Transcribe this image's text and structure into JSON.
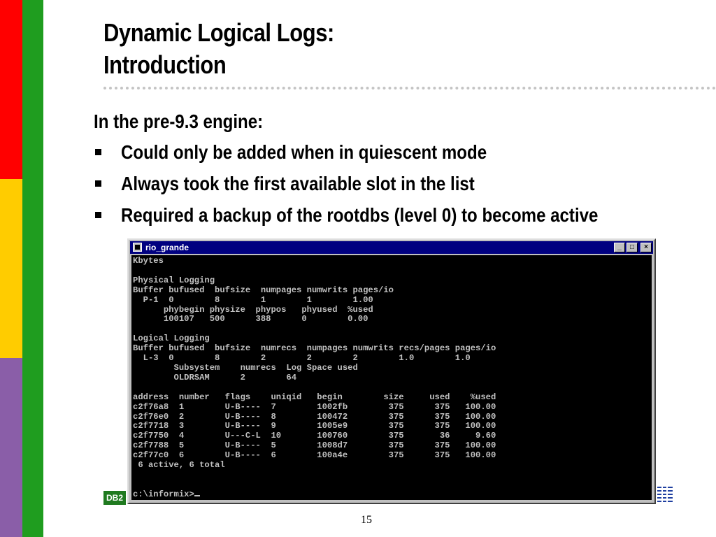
{
  "slide": {
    "title_line1": "Dynamic Logical Logs:",
    "title_line2": "Introduction",
    "intro": "In the pre-9.3 engine:",
    "bullets": [
      "Could only be added when in quiescent mode",
      "Always took the first available slot in the list",
      "Required a backup of the rootdbs (level 0) to become active"
    ],
    "page_number": "15",
    "db2_badge": "DB2",
    "colors": {
      "stripe_red": "#ff0000",
      "stripe_yellow": "#ffcc00",
      "stripe_purple": "#8a5ea8",
      "stripe_green": "#1f9d1f",
      "ibm_blue": "#1f3fa0"
    }
  },
  "window": {
    "title": "rio_grande",
    "minimize_label": "_",
    "maximize_label": "□",
    "close_label": "×",
    "console_text": "Kbytes\n\nPhysical Logging\nBuffer bufused  bufsize  numpages numwrits pages/io\n  P-1  0        8        1        1        1.00\n      phybegin physize  phypos   phyused  %used\n      100107   500      388      0        0.00\n\nLogical Logging\nBuffer bufused  bufsize  numrecs  numpages numwrits recs/pages pages/io\n  L-3  0        8        2        2        2        1.0        1.0\n        Subsystem    numrecs  Log Space used\n        OLDRSAM      2        64\n\naddress  number   flags    uniqid   begin        size     used    %used\nc2f76a8  1        U-B----  7        1002fb        375      375   100.00\nc2f76e0  2        U-B----  8        100472        375      375   100.00\nc2f7718  3        U-B----  9        1005e9        375      375   100.00\nc2f7750  4        U---C-L  10       100760        375       36     9.60\nc2f7788  5        U-B----  5        1008d7        375      375   100.00\nc2f77c0  6        U-B----  6        100a4e        375      375   100.00\n 6 active, 6 total\n\n\nc:\\informix>"
  }
}
